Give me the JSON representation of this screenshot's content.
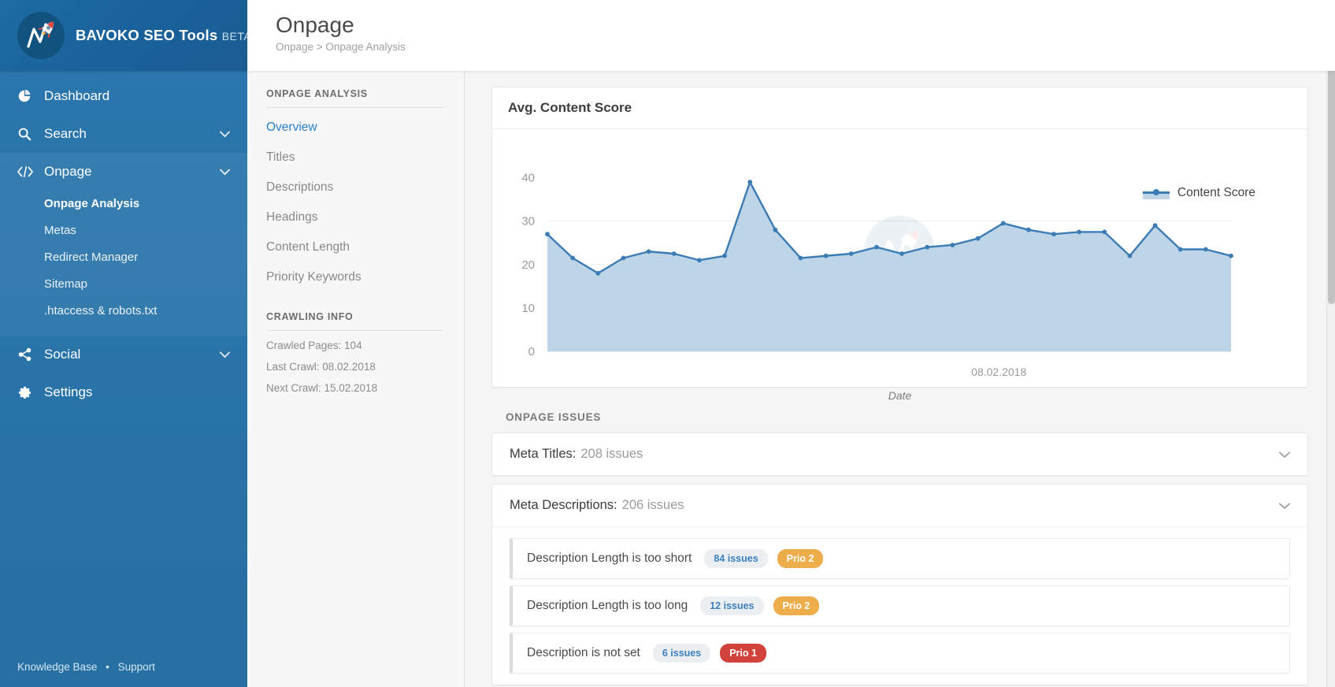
{
  "brand": {
    "name": "BAVOKO SEO Tools",
    "tag": "BETA",
    "logo_icon": "rocket-logo-icon"
  },
  "sidebar": {
    "items": [
      {
        "label": "Dashboard",
        "icon": "pie-chart-icon",
        "chevron": "",
        "expanded": false
      },
      {
        "label": "Search",
        "icon": "search-icon",
        "chevron": "⌄",
        "expanded": false
      },
      {
        "label": "Onpage",
        "icon": "code-icon",
        "chevron": "⌄",
        "expanded": true
      },
      {
        "label": "Social",
        "icon": "share-icon",
        "chevron": "⌄",
        "expanded": false
      },
      {
        "label": "Settings",
        "icon": "gear-icon",
        "chevron": "",
        "expanded": false
      }
    ],
    "onpage_children": [
      {
        "label": "Onpage Analysis",
        "active": true
      },
      {
        "label": "Metas",
        "active": false
      },
      {
        "label": "Redirect Manager",
        "active": false
      },
      {
        "label": "Sitemap",
        "active": false
      },
      {
        "label": ".htaccess & robots.txt",
        "active": false
      }
    ],
    "footer": {
      "knowledge_base": "Knowledge Base",
      "separator": "•",
      "support": "Support"
    }
  },
  "subpanel": {
    "heading_analysis": "ONPAGE ANALYSIS",
    "links": [
      {
        "label": "Overview",
        "active": true
      },
      {
        "label": "Titles",
        "active": false
      },
      {
        "label": "Descriptions",
        "active": false
      },
      {
        "label": "Headings",
        "active": false
      },
      {
        "label": "Content Length",
        "active": false
      },
      {
        "label": "Priority Keywords",
        "active": false
      }
    ],
    "heading_crawling": "CRAWLING INFO",
    "info": [
      "Crawled Pages: 104",
      "Last Crawl: 08.02.2018",
      "Next Crawl: 15.02.2018"
    ]
  },
  "header": {
    "title": "Onpage",
    "breadcrumb": "Onpage > Onpage Analysis"
  },
  "chart_card": {
    "title": "Avg. Content Score"
  },
  "chart_data": {
    "type": "area",
    "title": "Avg. Content Score",
    "xlabel": "Date",
    "ylabel": "",
    "ylim": [
      0,
      45
    ],
    "yticks": [
      0,
      10,
      20,
      30,
      40
    ],
    "grid": true,
    "legend_position": "top-right",
    "series": [
      {
        "name": "Content Score",
        "color": "#3b7cb5",
        "fill": "#bed5e8",
        "values": [
          27,
          21.5,
          18,
          21.5,
          23,
          22.5,
          21,
          22,
          39,
          28,
          21.5,
          22,
          22.5,
          24,
          22.5,
          24,
          24.5,
          26,
          29.5,
          28,
          27,
          27.5,
          27.5,
          22,
          29,
          23.5,
          23.5,
          22
        ]
      }
    ],
    "x_tick_labels": [
      "08.02.2018"
    ],
    "x_tick_positions": [
      0.62
    ]
  },
  "issues_section": {
    "label": "ONPAGE ISSUES",
    "groups": [
      {
        "name": "Meta Titles:",
        "count_text": "208 issues",
        "expanded": false,
        "chevron": "⌄",
        "rows": []
      },
      {
        "name": "Meta Descriptions:",
        "count_text": "206 issues",
        "expanded": true,
        "chevron": "⌄",
        "rows": [
          {
            "name": "Description Length is too short",
            "count": "84 issues",
            "prio": "Prio 2",
            "prio_level": 2
          },
          {
            "name": "Description Length is too long",
            "count": "12 issues",
            "prio": "Prio 2",
            "prio_level": 2
          },
          {
            "name": "Description is not set",
            "count": "6 issues",
            "prio": "Prio 1",
            "prio_level": 1
          }
        ]
      }
    ]
  },
  "colors": {
    "sidebar_blue": "#2a76ac",
    "brand_dark": "#1a6099",
    "accent_link": "#2a7fc9",
    "chart_line": "#3b7cb5",
    "chart_fill": "#bed5e8",
    "prio2_orange": "#edad4a",
    "prio1_red": "#d2423d"
  }
}
